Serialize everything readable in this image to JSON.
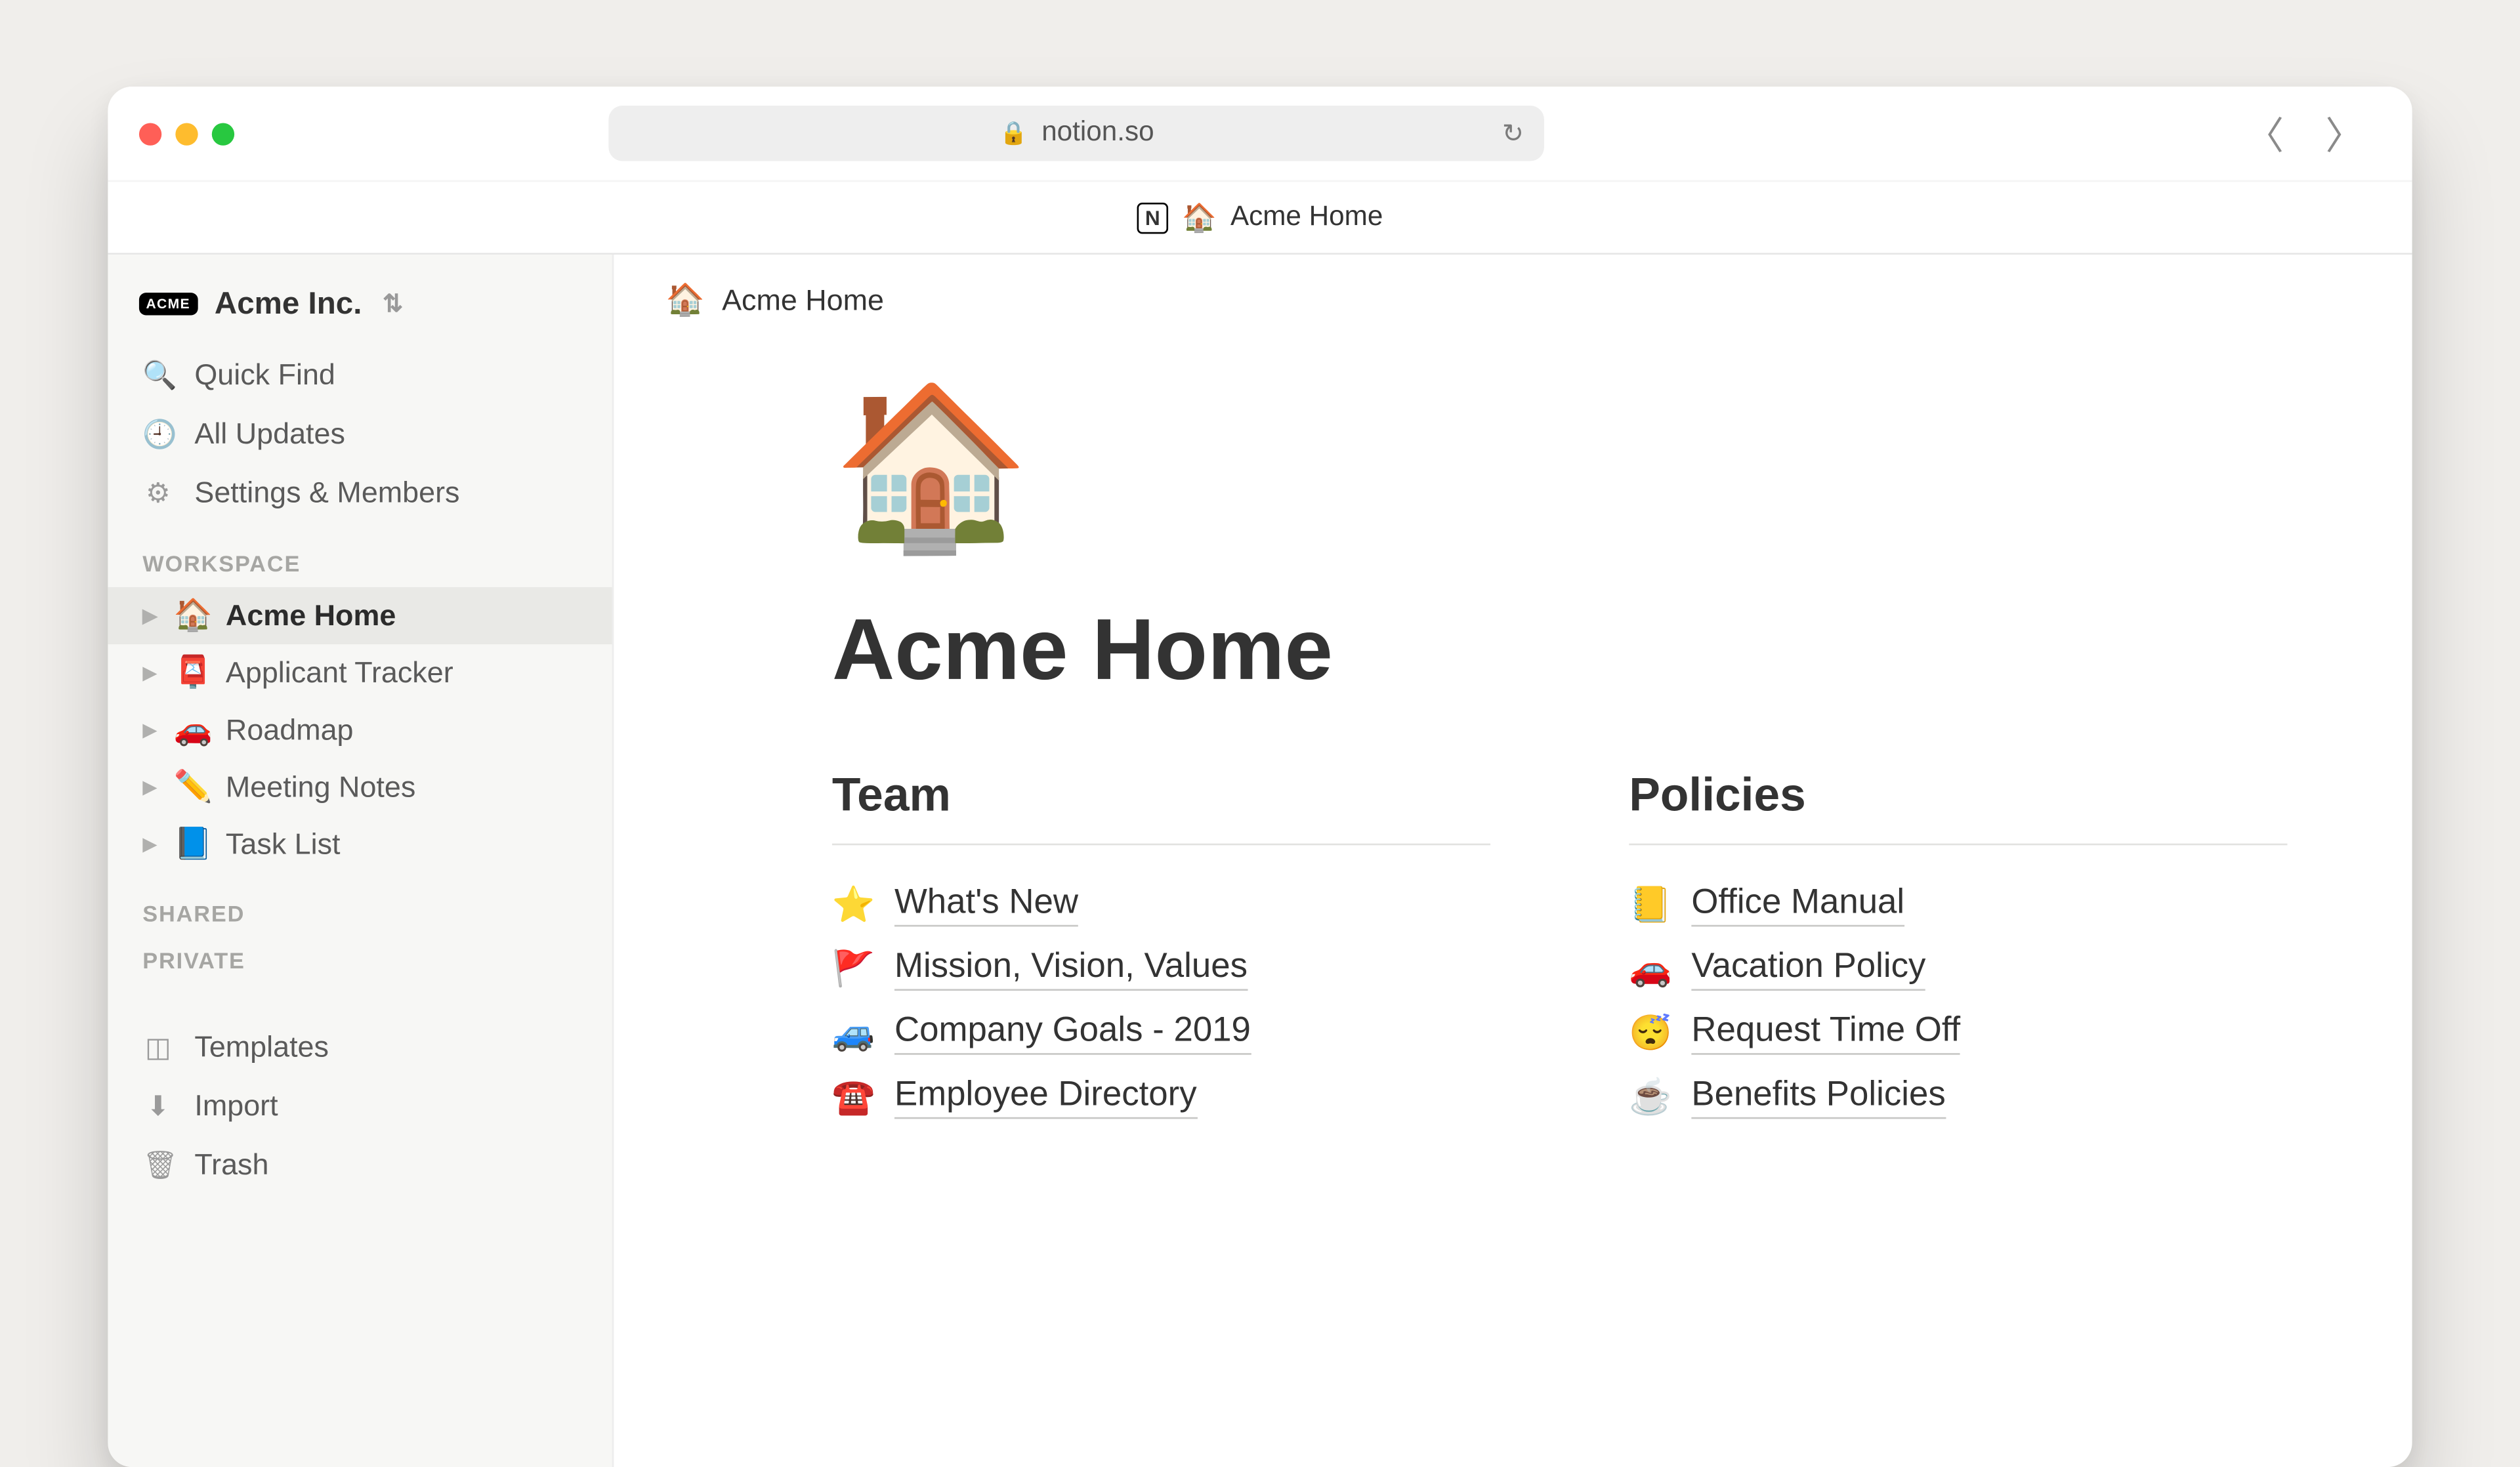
{
  "browser": {
    "url_host": "notion.so",
    "tab_emoji": "🏠",
    "tab_title": "Acme Home"
  },
  "sidebar": {
    "workspace_name": "Acme Inc.",
    "nav": {
      "quick_find": "Quick Find",
      "all_updates": "All Updates",
      "settings": "Settings & Members"
    },
    "sections": {
      "workspace": "WORKSPACE",
      "shared": "SHARED",
      "private": "PRIVATE"
    },
    "pages": [
      {
        "emoji": "🏠",
        "label": "Acme Home",
        "active": true
      },
      {
        "emoji": "📮",
        "label": "Applicant Tracker",
        "active": false
      },
      {
        "emoji": "🚗",
        "label": "Roadmap",
        "active": false
      },
      {
        "emoji": "✏️",
        "label": "Meeting Notes",
        "active": false
      },
      {
        "emoji": "📘",
        "label": "Task List",
        "active": false
      }
    ],
    "utils": {
      "templates": "Templates",
      "import": "Import",
      "trash": "Trash"
    }
  },
  "page": {
    "breadcrumb_emoji": "🏠",
    "breadcrumb_title": "Acme Home",
    "hero_emoji": "🏠",
    "title": "Acme Home",
    "col_team_heading": "Team",
    "col_policies_heading": "Policies",
    "team_links": [
      {
        "emoji": "⭐",
        "label": "What's New"
      },
      {
        "emoji": "🚩",
        "label": "Mission, Vision, Values"
      },
      {
        "emoji": "🚙",
        "label": "Company Goals - 2019"
      },
      {
        "emoji": "☎️",
        "label": "Employee Directory"
      }
    ],
    "policies_links": [
      {
        "emoji": "📒",
        "label": "Office Manual"
      },
      {
        "emoji": "🚗",
        "label": "Vacation Policy"
      },
      {
        "emoji": "😴",
        "label": "Request Time Off"
      },
      {
        "emoji": "☕",
        "label": "Benefits Policies"
      }
    ]
  }
}
